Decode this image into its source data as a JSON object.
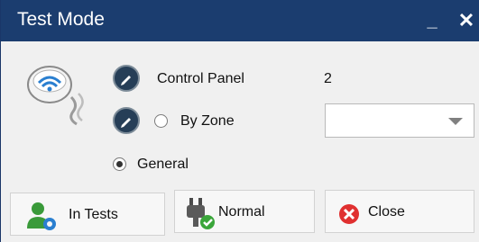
{
  "window": {
    "title": "Test Mode",
    "minimize_glyph": "_",
    "close_glyph": "✕"
  },
  "form": {
    "control_panel_label": "Control Panel",
    "control_panel_value": "2",
    "by_zone_label": "By Zone",
    "by_zone_selected": false,
    "zone_dropdown_value": "",
    "general_label": "General",
    "general_selected": true
  },
  "buttons": {
    "in_tests_label": "In Tests",
    "normal_label": "Normal",
    "close_label": "Close"
  },
  "icons": {
    "header": "smoke-detector-icon",
    "control_panel_edit": "pencil-icon",
    "zone_edit": "pencil-icon",
    "in_tests": "user-gear-icon",
    "normal": "plug-check-icon",
    "close": "red-x-circle-icon"
  },
  "colors": {
    "titlebar": "#1b3d6f",
    "edit_circle": "#263e57",
    "close_icon": "#e03030",
    "check_green": "#3aa63a"
  }
}
